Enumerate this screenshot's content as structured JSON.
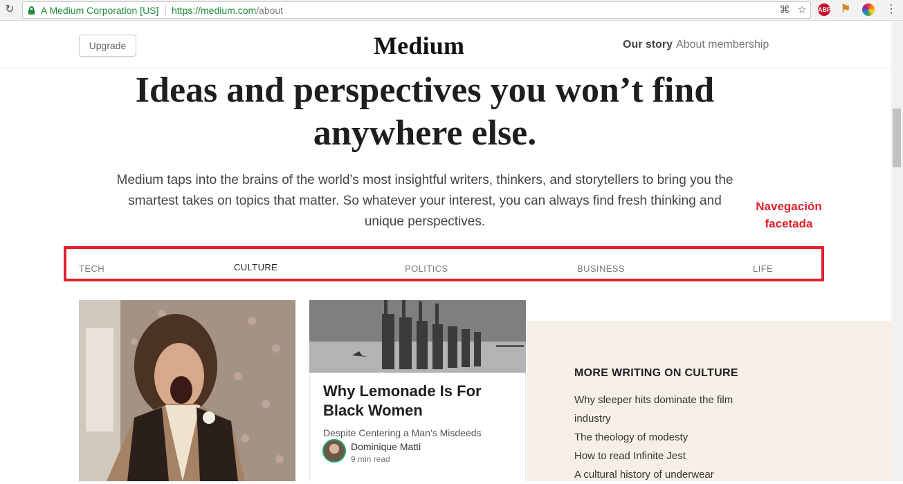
{
  "browser": {
    "ev_name": "A Medium Corporation [US]",
    "url_host": "https://medium.com",
    "url_path": "/about",
    "abp_label": "ABP",
    "reload_glyph": "↻",
    "translate_glyph": "⌘",
    "star_glyph": "☆",
    "flag_glyph": "⚑",
    "menu_glyph": "⋮"
  },
  "header": {
    "upgrade_label": "Upgrade",
    "logo": "Medium",
    "nav": {
      "our_story": "Our story",
      "about_membership": "About membership"
    }
  },
  "hero": {
    "title": "Ideas and perspectives you won’t find anywhere else.",
    "subtitle": "Medium taps into the brains of the world’s most insightful writers, thinkers, and storytellers to bring you the smartest takes on topics that matter. So whatever your interest, you can always find fresh thinking and unique perspectives."
  },
  "annotation": {
    "line1": "Navegación",
    "line2": "facetada",
    "color": "#e0202a"
  },
  "facets": [
    "TECH",
    "CULTURE",
    "POLITICS",
    "BUSINESS",
    "LIFE"
  ],
  "active_facet": "CULTURE",
  "featured_story": {
    "title": "Why Lemonade Is For Black Women",
    "subtitle": "Despite Centering a Man’s Misdeeds",
    "author": "Dominique Matti",
    "read_time": "9 min read"
  },
  "more_writing": {
    "heading": "MORE WRITING ON CULTURE",
    "links": [
      "Why sleeper hits dominate the film industry",
      "The theology of modesty",
      "How to read Infinite Jest",
      "A cultural history of underwear"
    ]
  },
  "colors": {
    "secure_green": "#1e8a3a",
    "highlight_red": "#e0202a",
    "panel_beige": "#f6efe5",
    "avatar_ring": "#1ba76b"
  }
}
